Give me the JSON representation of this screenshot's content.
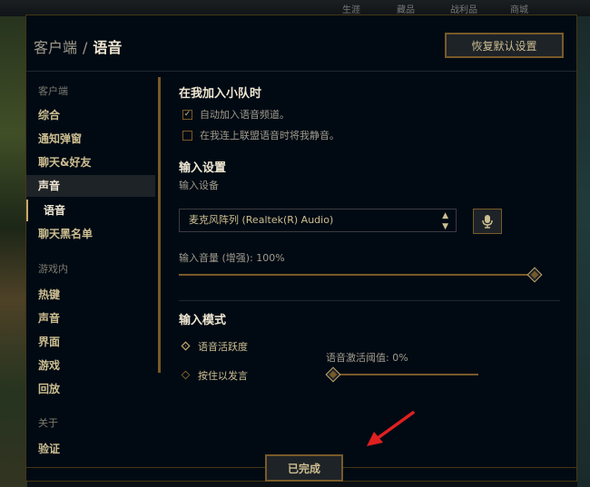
{
  "background": {
    "nav_items": [
      "生涯",
      "藏品",
      "战利品",
      "商城"
    ]
  },
  "header": {
    "breadcrumb_parent": "客户端",
    "breadcrumb_sep": "/",
    "breadcrumb_current": "语音",
    "restore_button": "恢复默认设置"
  },
  "sidebar": {
    "sections": [
      {
        "label": "客户端",
        "header": true
      },
      {
        "label": "综合"
      },
      {
        "label": "通知弹窗"
      },
      {
        "label": "聊天&好友"
      },
      {
        "label": "声音",
        "active": true
      },
      {
        "label": "语音",
        "sub_active": true
      },
      {
        "label": "聊天黑名单"
      },
      {
        "label": "游戏内",
        "header": true
      },
      {
        "label": "热键"
      },
      {
        "label": "声音"
      },
      {
        "label": "界面"
      },
      {
        "label": "游戏"
      },
      {
        "label": "回放"
      },
      {
        "label": "关于",
        "header": true
      },
      {
        "label": "验证"
      }
    ]
  },
  "party": {
    "title": "在我加入小队时",
    "auto_join_label": "自动加入语音频道。",
    "auto_join_checked": true,
    "mute_label": "在我连上联盟语音时将我静音。",
    "mute_checked": false
  },
  "input": {
    "title": "输入设置",
    "device_label": "输入设备",
    "device_value": "麦克风阵列 (Realtek(R) Audio)",
    "volume_label": "输入音量 (增强): 100%",
    "volume_fraction": 1.0
  },
  "mode": {
    "title": "输入模式",
    "voice_activity_label": "语音活跃度",
    "push_to_talk_label": "按住以发言",
    "selected": "voice_activity",
    "threshold_label": "语音激活阈值: 0%",
    "threshold_fraction": 0.0
  },
  "footer": {
    "done_button": "已完成"
  },
  "colors": {
    "gold": "#c8aa6e",
    "gold_dark": "#785a28",
    "text_light": "#f0e6d2",
    "annotation_arrow": "#e02020"
  }
}
